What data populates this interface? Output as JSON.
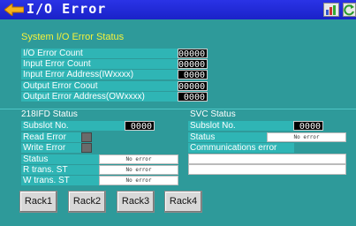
{
  "window": {
    "title": "I/O Error"
  },
  "icons": {
    "back": "left-arrow-icon",
    "chart": "bar-chart-icon",
    "refresh": "refresh-icon"
  },
  "system_status": {
    "heading": "System I/O Error Status",
    "rows": [
      {
        "label": "I/O Error Count",
        "value": "00000"
      },
      {
        "label": "Input Error Count",
        "value": "00000"
      },
      {
        "label": "Input Error Address(IWxxxx)",
        "value": "0000"
      },
      {
        "label": "Output Error Coout",
        "value": "00000"
      },
      {
        "label": "Output Error Address(OWxxxx)",
        "value": "0000"
      }
    ]
  },
  "fd_status": {
    "heading": "218IFD Status",
    "subslot_label": "Subslot No.",
    "subslot_value": "0000",
    "read_error_label": "Read Error",
    "write_error_label": "Write Error",
    "status_label": "Status",
    "status_value": "No error",
    "r_trans_label": "R trans. ST",
    "r_trans_value": "No error",
    "w_trans_label": "W trans. ST",
    "w_trans_value": "No error"
  },
  "svc_status": {
    "heading": "SVC Status",
    "subslot_label": "Subslot No.",
    "subslot_value": "0000",
    "status_label": "Status",
    "status_value": "No error",
    "comm_error_label": "Communications error"
  },
  "rack_buttons": [
    "Rack1",
    "Rack2",
    "Rack3",
    "Rack4"
  ],
  "colors": {
    "background": "#2e9a9a",
    "titlebar": "#1a22c8",
    "label_bg": "#2fb5b5",
    "heading": "#f5f23a"
  }
}
